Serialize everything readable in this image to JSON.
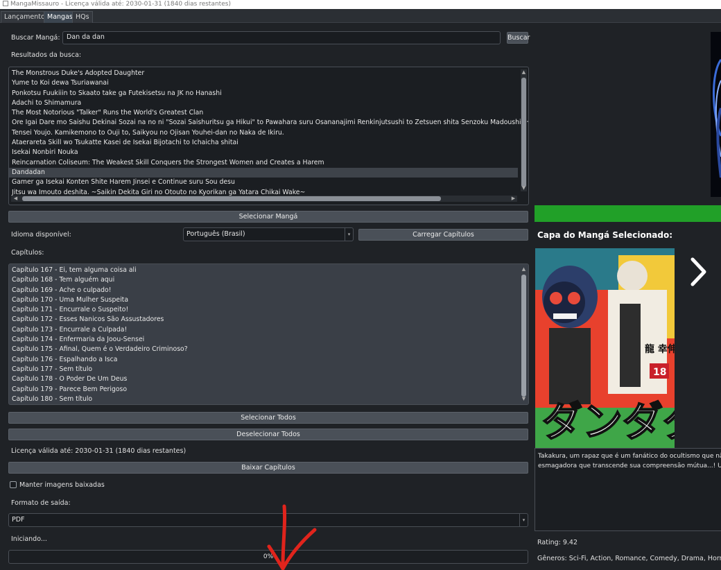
{
  "window": {
    "title": "MangaMissauro - Licença válida até: 2030-01-31 (1840 dias restantes)"
  },
  "tabs": [
    {
      "label": "Lançamento"
    },
    {
      "label": "Mangas"
    },
    {
      "label": "HQs"
    }
  ],
  "search": {
    "label": "Buscar Mangá:",
    "value": "Dan da dan",
    "button_label": "Buscar",
    "results_label": "Resultados da busca:",
    "results": [
      "The Monstrous Duke's Adopted Daughter",
      "Yume to Koi dewa Tsuriawanai",
      "Ponkotsu Fuukiiin to Skaato take ga Futekisetsu na JK no Hanashi",
      "Adachi to Shimamura",
      "The Most Notorious \"Talker\" Runs the World's Greatest Clan",
      "Ore Igai Dare mo Saishu Dekinai Sozai na no ni \"Sozai Saishuritsu ga Hikui\" to Pawahara suru Osananajimi Renkinjutsushi to Zetsuen shita Senzoku Madoushi, Henkyou no Ma",
      "Tensei Youjo. Kamikemono to Ouji to, Saikyou no Ojisan Youhei-dan no Naka de Ikiru.",
      "Ataerareta Skill wo Tsukatte Kasei de Isekai Bijotachi to Ichaicha shitai",
      "Isekai Nonbiri Nouka",
      "Reincarnation Coliseum: The Weakest Skill Conquers the Strongest Women and Creates a Harem",
      "Dandadan",
      "Gamer ga Isekai Konten Shite Harem Jinsei e Continue suru Sou desu",
      "Jitsu wa Imouto deshita. ~Saikin Dekita Giri no Otouto no Kyorikan ga Yatara Chikai Wake~"
    ],
    "selected_index": 10
  },
  "select_manga_button": "Selecionar Mangá",
  "language": {
    "label": "Idioma disponível:",
    "value": "Português (Brasil)",
    "load_button": "Carregar Capítulos"
  },
  "chapters": {
    "label": "Capítulos:",
    "items": [
      "Capítulo 167 - Ei, tem alguma coisa ali",
      "Capítulo 168 - Tem alguém aqui",
      "Capítulo 169 - Ache o culpado!",
      "Capítulo 170 - Uma Mulher Suspeita",
      "Capítulo 171 - Encurrale o Suspeito!",
      "Capítulo 172 - Esses Nanicos São Assustadores",
      "Capítulo 173 - Encurrale a Culpada!",
      "Capítulo 174 - Enfermaria da Joou-Sensei",
      "Capítulo 175 - Afinal, Quem é o Verdadeiro Criminoso?",
      "Capítulo 176 - Espalhando a Isca",
      "Capítulo 177 - Sem título",
      "Capítulo 178 - O Poder De Um Deus",
      "Capítulo 179 - Parece Bem Perigoso",
      "Capítulo 180 - Sem título"
    ]
  },
  "select_all_button": "Selecionar Todos",
  "deselect_all_button": "Deselecionar Todos",
  "license_text": "Licença válida até: 2030-01-31 (1840 dias restantes)",
  "download_button": "Baixar Capítulos",
  "keep_images": {
    "label": "Manter imagens baixadas",
    "checked": false
  },
  "output_format": {
    "label": "Formato de saída:",
    "value": "PDF"
  },
  "status_text": "Iniciando...",
  "progress": {
    "value": 0,
    "text": "0%"
  },
  "cover_panel": {
    "title": "Capa do Mangá Selecionado:",
    "cover_title_art": "ダンダダン",
    "cover_volume": "18",
    "cover_author_art": "龍 幸伸",
    "synopsis_line1": "Takakura, um rapaz que é um fanático do ocultismo que não a",
    "synopsis_line2": "esmagadora que transcende sua compreensão mútua...! Uma h",
    "rating": "Rating: 9.42",
    "genres": "Gêneros: Sci-Fi, Action, Romance, Comedy, Drama, Horror, Slic"
  },
  "colors": {
    "accent_green": "#21a028",
    "annotation_red": "#e0241c",
    "background": "#1f2226"
  }
}
